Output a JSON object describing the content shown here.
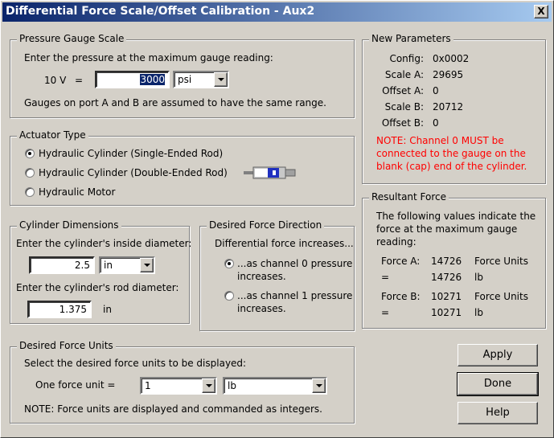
{
  "window": {
    "title": "Differential Force Scale/Offset Calibration - Aux2",
    "close_label": "X"
  },
  "pressure": {
    "legend": "Pressure Gauge Scale",
    "prompt": "Enter the pressure at the maximum gauge reading:",
    "volt_label": "10 V",
    "equals": "=",
    "value": "3000",
    "unit": "psi",
    "note": "Gauges on port A and B are assumed to have the same range."
  },
  "actuator": {
    "legend": "Actuator Type",
    "options": [
      "Hydraulic Cylinder (Single-Ended Rod)",
      "Hydraulic Cylinder (Double-Ended Rod)",
      "Hydraulic Motor"
    ],
    "selected_index": 0
  },
  "cylinder": {
    "legend": "Cylinder Dimensions",
    "inside_prompt": "Enter the cylinder's inside diameter:",
    "inside_value": "2.5",
    "inside_unit": "in",
    "rod_prompt": "Enter the cylinder's rod diameter:",
    "rod_value": "1.375",
    "rod_unit": "in"
  },
  "direction": {
    "legend": "Desired Force Direction",
    "prompt": "Differential force increases...",
    "option0_line1": "...as channel 0 pressure",
    "option0_line2": "increases.",
    "option1_line1": "...as channel 1 pressure",
    "option1_line2": "increases.",
    "selected_index": 0
  },
  "units": {
    "legend": "Desired Force Units",
    "prompt": "Select the desired force units to be displayed:",
    "one_unit_label": "One force unit =",
    "multiplier": "1",
    "unit": "lb",
    "note": "NOTE: Force units are displayed and commanded as integers."
  },
  "params": {
    "legend": "New Parameters",
    "rows": [
      {
        "label": "Config:",
        "value": "0x0002"
      },
      {
        "label": "Scale A:",
        "value": "29695"
      },
      {
        "label": "Offset A:",
        "value": "0"
      },
      {
        "label": "Scale B:",
        "value": "20712"
      },
      {
        "label": "Offset B:",
        "value": "0"
      }
    ],
    "note_line1": "NOTE: Channel 0 MUST be",
    "note_line2": "connected to the gauge on the",
    "note_line3": "blank (cap) end of the cylinder.",
    "note_color": "#ff0000"
  },
  "resultant": {
    "legend": "Resultant Force",
    "desc_line1": "The following values indicate the",
    "desc_line2": "force at the maximum gauge",
    "desc_line3": "reading:",
    "force_a_label": "Force A:",
    "force_a_value": "14726",
    "force_a_unit": "Force Units",
    "force_a_eq": "=",
    "force_a_lb": "14726",
    "force_a_lb_unit": "lb",
    "force_b_label": "Force B:",
    "force_b_value": "10271",
    "force_b_unit": "Force Units",
    "force_b_eq": "=",
    "force_b_lb": "10271",
    "force_b_lb_unit": "lb"
  },
  "buttons": {
    "apply": "Apply",
    "done": "Done",
    "help": "Help"
  },
  "icons": {
    "cylinder": "hydraulic-cylinder-icon"
  },
  "colors": {
    "title_start": "#0a246a",
    "title_end": "#a6caf0",
    "face": "#d4d0c8"
  }
}
